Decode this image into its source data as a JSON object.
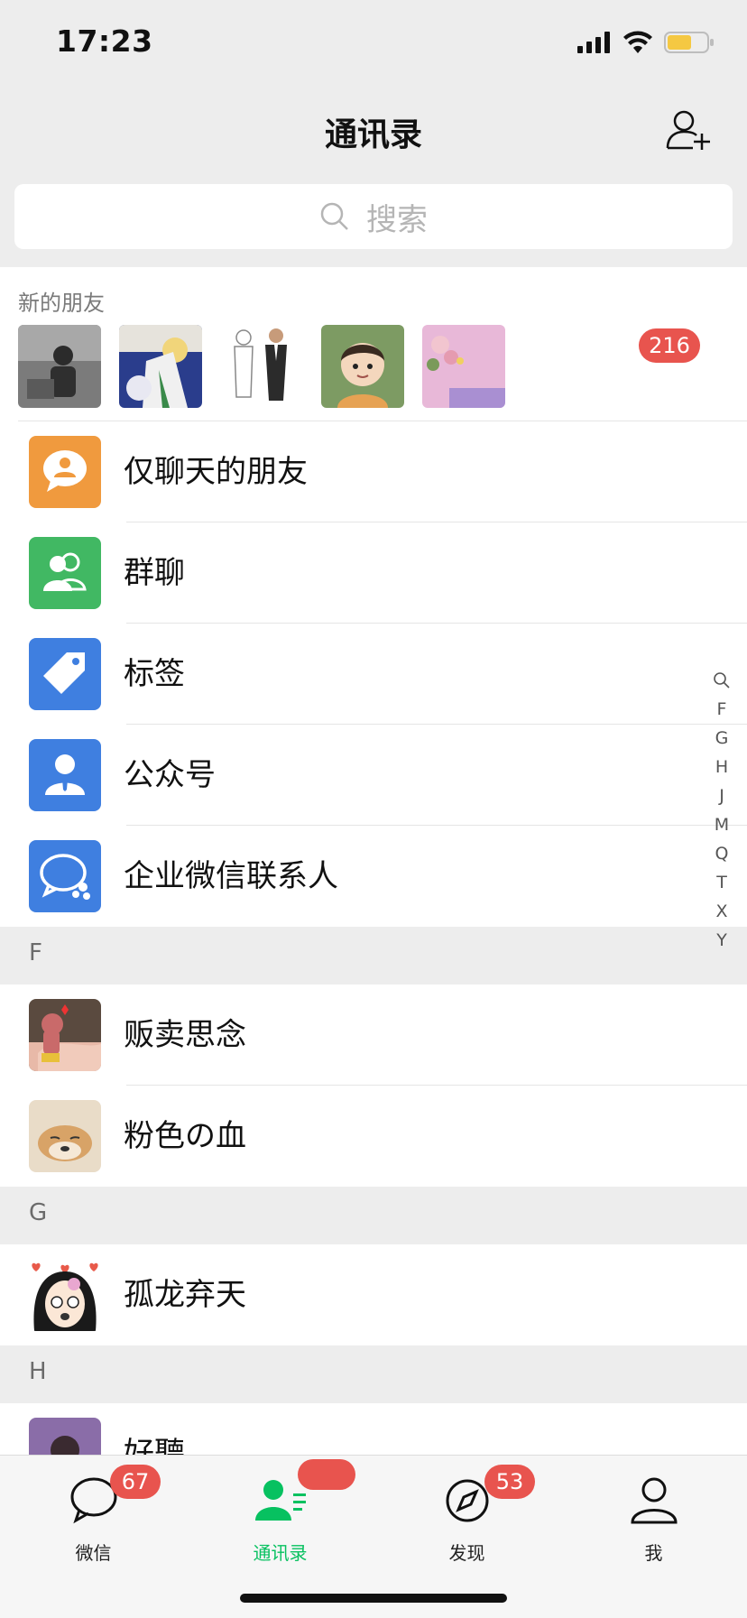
{
  "status": {
    "time": "17:23",
    "battery_color": "#f5c842"
  },
  "nav": {
    "title": "通讯录",
    "add_icon": "person-add-icon"
  },
  "search": {
    "placeholder": "搜索"
  },
  "new_friends": {
    "label": "新的朋友",
    "count": "216",
    "avatars": [
      "photo-bw-person",
      "anime-boys",
      "suited-men-sketch",
      "cartoon-boy",
      "flowers-girl"
    ]
  },
  "features": [
    {
      "label": "仅聊天的朋友",
      "icon": "chat-friend-icon",
      "color": "#f09a3e"
    },
    {
      "label": "群聊",
      "icon": "group-icon",
      "color": "#41b863"
    },
    {
      "label": "标签",
      "icon": "tag-icon",
      "color": "#3f7fe0"
    },
    {
      "label": "公众号",
      "icon": "official-account-icon",
      "color": "#3f7fe0"
    },
    {
      "label": "企业微信联系人",
      "icon": "work-wechat-icon",
      "color": "#3f7fe0"
    }
  ],
  "sections": [
    {
      "letter": "F",
      "contacts": [
        "贩卖思念",
        "粉色の血"
      ]
    },
    {
      "letter": "G",
      "contacts": [
        "孤龙弃天"
      ]
    },
    {
      "letter": "H",
      "contacts": [
        "好聽"
      ]
    }
  ],
  "index": [
    "F",
    "G",
    "H",
    "J",
    "M",
    "Q",
    "T",
    "X",
    "Y"
  ],
  "tabs": [
    {
      "label": "微信",
      "badge": "67"
    },
    {
      "label": "通讯录",
      "badge": ""
    },
    {
      "label": "发现",
      "badge": "53"
    },
    {
      "label": "我",
      "badge": ""
    }
  ],
  "colors": {
    "accent_green": "#07c160",
    "badge_red": "#e8544e"
  }
}
